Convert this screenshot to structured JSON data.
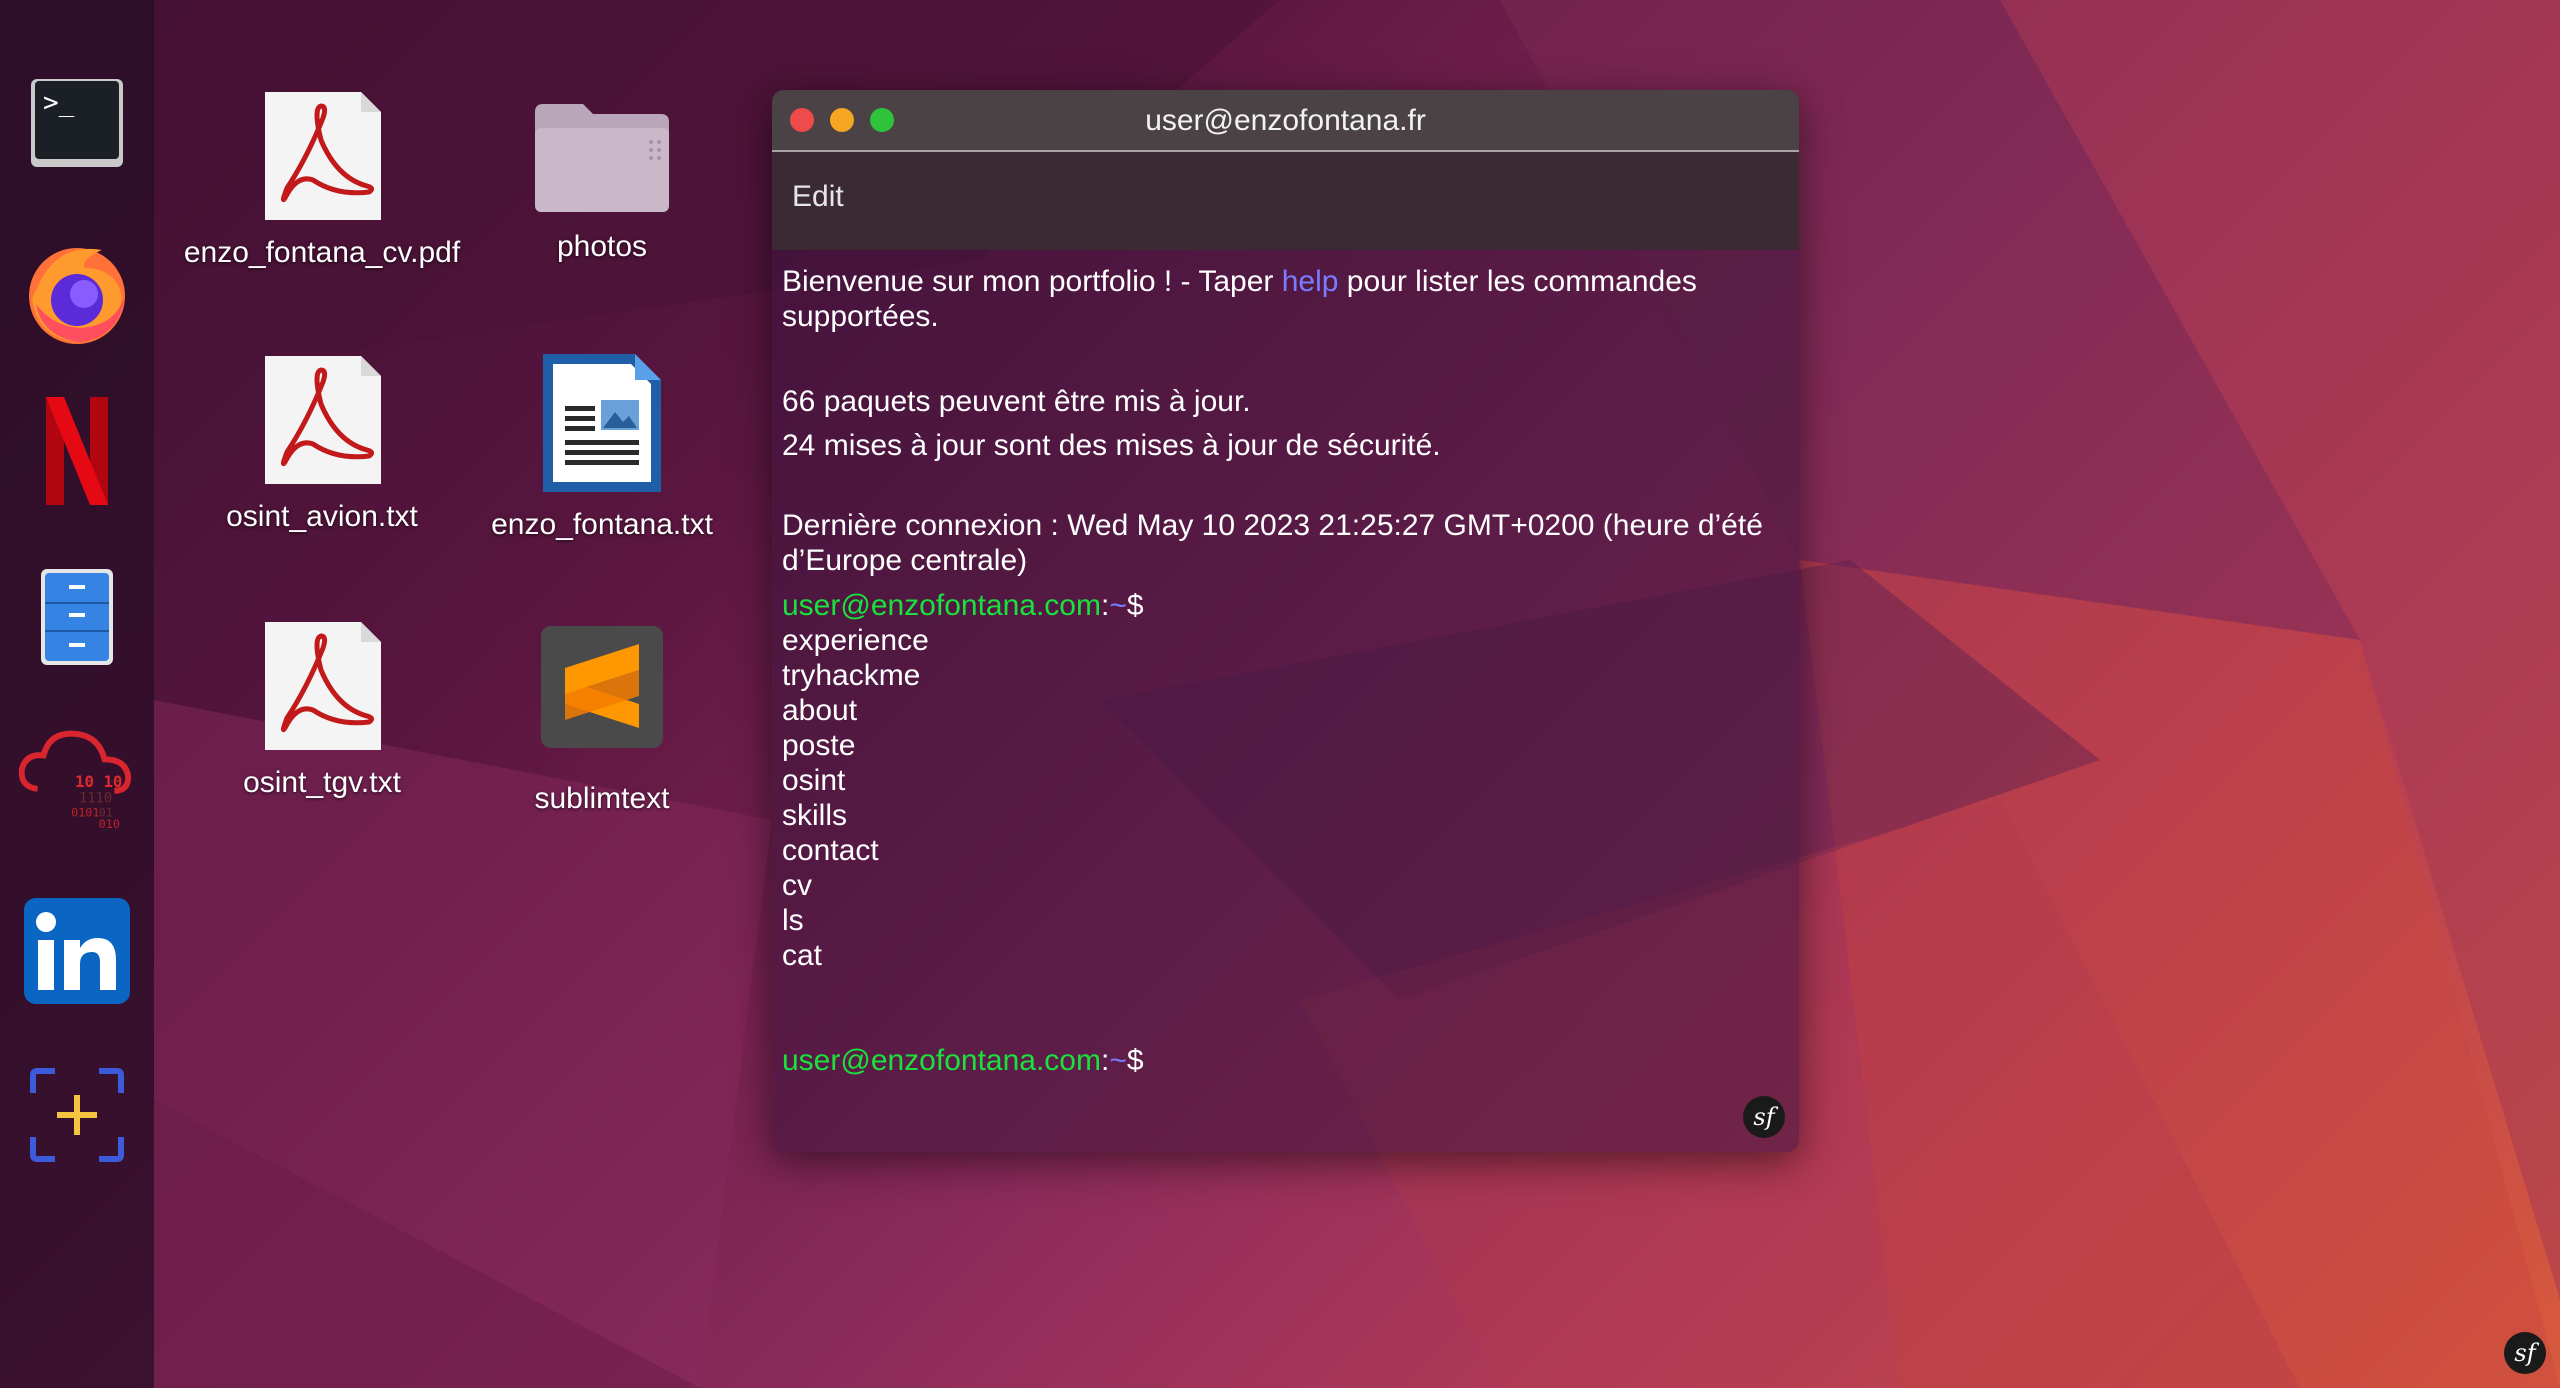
{
  "window": {
    "title": "user@enzofontana.fr",
    "menu": {
      "edit_label": "Edit"
    }
  },
  "dock": {
    "items": [
      {
        "name": "terminal",
        "icon": "terminal-icon"
      },
      {
        "name": "firefox",
        "icon": "firefox-icon"
      },
      {
        "name": "netflix",
        "icon": "netflix-icon"
      },
      {
        "name": "file-cabinet",
        "icon": "file-cabinet-icon"
      },
      {
        "name": "cloud-binary",
        "icon": "cloud-binary-icon"
      },
      {
        "name": "linkedin",
        "icon": "linkedin-icon"
      },
      {
        "name": "screenshot-add",
        "icon": "screenshot-add-icon"
      }
    ],
    "cloud_digits": [
      "10 10",
      "1110",
      "0101",
      "01",
      "010"
    ]
  },
  "desktop": {
    "icons": [
      {
        "label": "enzo_fontana_cv.pdf",
        "icon": "pdf-icon"
      },
      {
        "label": "photos",
        "icon": "folder-icon"
      },
      {
        "label": "osint_avion.txt",
        "icon": "pdf-icon"
      },
      {
        "label": "enzo_fontana.txt",
        "icon": "writer-document-icon"
      },
      {
        "label": "osint_tgv.txt",
        "icon": "pdf-icon"
      },
      {
        "label": "sublimtext",
        "icon": "sublime-text-icon"
      }
    ]
  },
  "terminal": {
    "welcome_prefix": "Bienvenue sur mon portfolio ! - Taper ",
    "welcome_help": "help",
    "welcome_suffix": " pour lister les commandes supportées.",
    "updates_line1": "66 paquets peuvent être mis à jour.",
    "updates_line2": "24 mises à jour sont des mises à jour de sécurité.",
    "last_login": "Dernière connexion : Wed May 10 2023 21:25:27 GMT+0200 (heure d’été d’Europe centrale)",
    "prompt_user": "user@enzofontana.com",
    "prompt_sep": ":",
    "prompt_path": "~",
    "prompt_symbol": "$",
    "commands": [
      "experience",
      "tryhackme",
      "about",
      "poste",
      "osint",
      "skills",
      "contact",
      "cv",
      "ls",
      "cat"
    ]
  },
  "badges": {
    "symfony": "sf"
  },
  "colors": {
    "prompt_green": "#19e23c",
    "path_blue": "#7a7cff",
    "close": "#ee4b4b",
    "minimize": "#f5a623",
    "maximize": "#2ec33a"
  }
}
